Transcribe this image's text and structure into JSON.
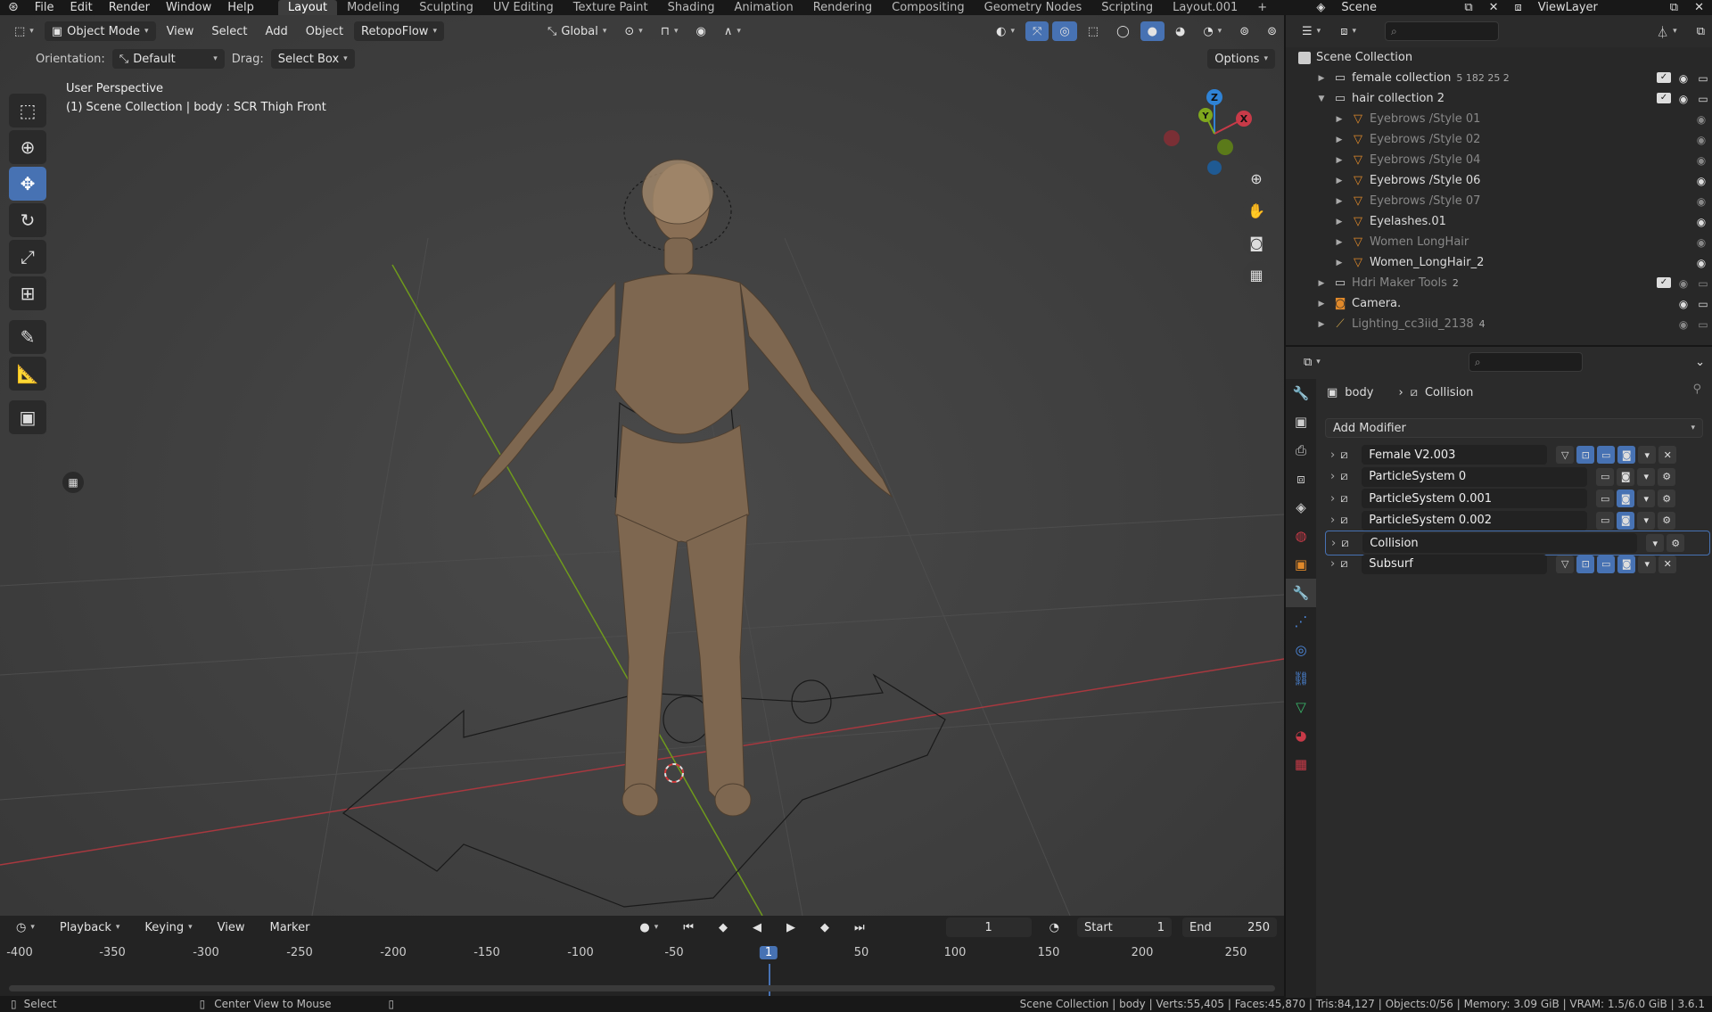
{
  "menubar": {
    "items": [
      "File",
      "Edit",
      "Render",
      "Window",
      "Help"
    ],
    "workspaces": [
      "Layout",
      "Modeling",
      "Sculpting",
      "UV Editing",
      "Texture Paint",
      "Shading",
      "Animation",
      "Rendering",
      "Compositing",
      "Geometry Nodes",
      "Scripting",
      "Layout.001"
    ],
    "active_workspace": "Layout",
    "scene": "Scene",
    "view_layer": "ViewLayer"
  },
  "viewport": {
    "mode": "Object Mode",
    "menus": [
      "View",
      "Select",
      "Add",
      "Object"
    ],
    "addon_menu": "RetopoFlow",
    "transform_orientation": "Global",
    "orientation_label": "Orientation:",
    "orientation_value": "Default",
    "drag_label": "Drag:",
    "drag_value": "Select Box",
    "options": "Options",
    "perspective": "User Perspective",
    "info": "(1) Scene Collection | body  : SCR Thigh Front",
    "gizmo_axes": [
      "X",
      "Y",
      "Z"
    ]
  },
  "timeline": {
    "menus": [
      "Playback",
      "Keying",
      "View",
      "Marker"
    ],
    "current_frame": "1",
    "start_label": "Start",
    "start": "1",
    "end_label": "End",
    "end": "250",
    "ticks": [
      "-400",
      "-350",
      "-300",
      "-250",
      "-200",
      "-150",
      "-100",
      "-50",
      "1",
      "50",
      "100",
      "150",
      "200",
      "250"
    ]
  },
  "statusbar": {
    "left_action": "Select",
    "middle_action": "Center View to Mouse",
    "stats": "Scene Collection | body | Verts:55,405 | Faces:45,870 | Tris:84,127 | Objects:0/56 | Memory: 3.09 GiB | VRAM: 1.5/6.0 GiB | 3.6.1"
  },
  "outliner": {
    "root": "Scene Collection",
    "rows": [
      {
        "name": "female collection",
        "indent": 1,
        "expanded": false,
        "dim": false,
        "type": "collection",
        "badges": "5 182 25 2"
      },
      {
        "name": "hair collection 2",
        "indent": 1,
        "expanded": true,
        "dim": false,
        "type": "collection",
        "badges": ""
      },
      {
        "name": "Eyebrows /Style 01",
        "indent": 2,
        "expanded": false,
        "dim": true,
        "type": "mesh",
        "badges": ""
      },
      {
        "name": "Eyebrows /Style 02",
        "indent": 2,
        "expanded": false,
        "dim": true,
        "type": "mesh",
        "badges": ""
      },
      {
        "name": "Eyebrows /Style 04",
        "indent": 2,
        "expanded": false,
        "dim": true,
        "type": "mesh",
        "badges": ""
      },
      {
        "name": "Eyebrows /Style 06",
        "indent": 2,
        "expanded": false,
        "dim": false,
        "type": "mesh",
        "badges": ""
      },
      {
        "name": "Eyebrows /Style 07",
        "indent": 2,
        "expanded": false,
        "dim": true,
        "type": "mesh",
        "badges": ""
      },
      {
        "name": "Eyelashes.01",
        "indent": 2,
        "expanded": false,
        "dim": false,
        "type": "mesh",
        "badges": ""
      },
      {
        "name": "Women LongHair",
        "indent": 2,
        "expanded": false,
        "dim": true,
        "type": "mesh",
        "badges": ""
      },
      {
        "name": "Women_LongHair_2",
        "indent": 2,
        "expanded": false,
        "dim": false,
        "type": "mesh",
        "badges": ""
      },
      {
        "name": "Hdri Maker Tools",
        "indent": 1,
        "expanded": false,
        "dim": true,
        "type": "collection",
        "badges": "2"
      },
      {
        "name": "Camera.",
        "indent": 1,
        "expanded": false,
        "dim": false,
        "type": "camera",
        "badges": ""
      },
      {
        "name": "Lighting_cc3iid_2138",
        "indent": 1,
        "expanded": false,
        "dim": true,
        "type": "armature",
        "badges": "4"
      }
    ]
  },
  "properties": {
    "object": "body",
    "modifier_context": "Collision",
    "add_modifier": "Add Modifier",
    "modifiers": [
      {
        "name": "Female V2.003",
        "selected": false
      },
      {
        "name": "ParticleSystem 0",
        "selected": false
      },
      {
        "name": "ParticleSystem 0.001",
        "selected": false
      },
      {
        "name": "ParticleSystem 0.002",
        "selected": false
      },
      {
        "name": "Collision",
        "selected": true
      },
      {
        "name": "Subsurf",
        "selected": false
      }
    ]
  },
  "colors": {
    "accent": "#4772b3",
    "x_axis": "#c83a48",
    "y_axis": "#7fa81d",
    "z_axis": "#2f83d6"
  }
}
